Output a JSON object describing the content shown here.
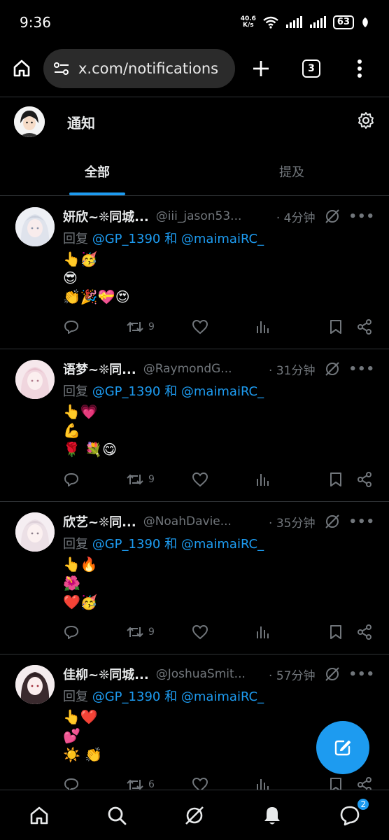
{
  "status_bar": {
    "time": "9:36",
    "net_speed_value": "40.6",
    "net_speed_unit": "K/s",
    "battery": "63"
  },
  "browser": {
    "url": "x.com/notifications",
    "tab_count": "3"
  },
  "header": {
    "title": "通知"
  },
  "tabs": [
    {
      "label": "全部",
      "active": true
    },
    {
      "label": "提及",
      "active": false
    }
  ],
  "tweets": [
    {
      "name": "妍欣~❊同城...",
      "handle": "@iii_jason53...",
      "time": "· 4分钟",
      "reply_prefix": "回复 ",
      "mention1": "@GP_1390",
      "and": " 和 ",
      "mention2": "@maimaiRC_",
      "lines": [
        "👆🥳",
        "😎",
        "👏🎉💝😍"
      ],
      "retweets": "9"
    },
    {
      "name": "语梦~❊同...",
      "handle": "@RaymondG...",
      "time": "· 31分钟",
      "reply_prefix": "回复 ",
      "mention1": "@GP_1390",
      "and": " 和 ",
      "mention2": "@maimaiRC_",
      "lines": [
        "👆💗",
        "💪",
        "🌹 💐😋"
      ],
      "retweets": "9"
    },
    {
      "name": "欣艺~❊同...",
      "handle": "@NoahDavie...",
      "time": "· 35分钟",
      "reply_prefix": "回复 ",
      "mention1": "@GP_1390",
      "and": " 和 ",
      "mention2": "@maimaiRC_",
      "lines": [
        "👆🔥",
        "🌺",
        "❤️🥳"
      ],
      "retweets": "9"
    },
    {
      "name": "佳柳~❊同城...",
      "handle": "@JoshuaSmit...",
      "time": "· 57分钟",
      "reply_prefix": "回复 ",
      "mention1": "@GP_1390",
      "and": " 和 ",
      "mention2": "@maimaiRC_",
      "lines": [
        "👆❤️",
        "💕",
        "☀️ 👏"
      ],
      "retweets": "6"
    }
  ],
  "bottom_nav": {
    "messages_badge": "2"
  },
  "colors": {
    "accent": "#1d9bf0",
    "background": "#000000",
    "muted": "#71767b"
  }
}
